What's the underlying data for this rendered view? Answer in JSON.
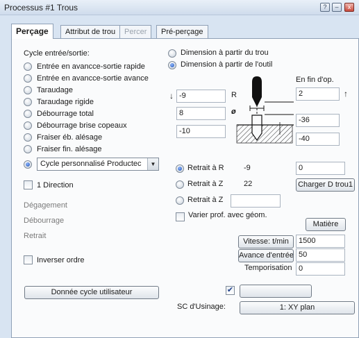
{
  "window": {
    "title": "Processus #1 Trous",
    "btn_help": "?",
    "btn_min": "–",
    "btn_close": "x"
  },
  "tabs": [
    {
      "label": "Perçage",
      "state": "active"
    },
    {
      "label": "Attribut de trou",
      "state": "normal"
    },
    {
      "label": "Percer",
      "state": "disabled"
    },
    {
      "label": "Pré-perçage",
      "state": "normal"
    }
  ],
  "cycle": {
    "heading": "Cycle entrée/sortie:",
    "options": [
      "Entrée en avancce-sortie rapide",
      "Entrée en avancce-sortie avance",
      "Taraudage",
      "Taraudage rigide",
      "Débourrage total",
      "Débourrage brise copeaux",
      "Fraiser éb. alésage",
      "Fraiser fin. alésage"
    ],
    "selected_combo": "Cycle personnalisé Productec"
  },
  "dimension": {
    "from_hole": "Dimension à partir du trou",
    "from_tool": "Dimension à partir de l'outil"
  },
  "depth": {
    "start_value": "-9",
    "r_label": "R",
    "diameter_value": "8",
    "diameter_symbol": "ø",
    "bottom_value": "-10",
    "end_heading": "En fin d'op.",
    "end_top": "2",
    "end_mid": "-36",
    "end_bottom": "-40"
  },
  "retract": {
    "to_r_label": "Retrait à R",
    "to_r_value": "-9",
    "to_z_label": "Retrait à Z",
    "to_z_value": "22",
    "to_z2_label": "Retrait à Z",
    "to_z2_value": "",
    "right_value": "0",
    "charger_button": "Charger D trou1"
  },
  "one_direction": "1 Direction",
  "muted_labels": {
    "degagement": "Dégagement",
    "debourrage": "Débourrage",
    "retrait": "Retrait"
  },
  "varier": "Varier prof. avec géom.",
  "matiere_button": "Matière",
  "vitesse": {
    "label": "Vitesse: t/min",
    "value": "1500"
  },
  "avance": {
    "label": "Avance d'entrée",
    "value": "50"
  },
  "tempo": {
    "label": "Temporisation",
    "value": "0"
  },
  "inverser": "Inverser ordre",
  "user_cycle_button": "Donnée cycle utilisateur",
  "blank_button": "",
  "sc_usinage": {
    "label": "SC d'Usinage:",
    "button": "1: XY plan"
  },
  "colors": {
    "accent": "#1e4fb0",
    "panel_bg": "#fafbfc",
    "window_bg": "#d8e4f2"
  }
}
